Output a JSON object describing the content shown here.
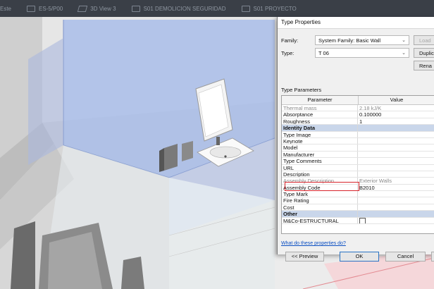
{
  "view_tabs": [
    {
      "label": "Este",
      "icon": "elevation-view-icon"
    },
    {
      "label": "ES-5/P00",
      "icon": "sheet-view-icon"
    },
    {
      "label": "3D View 3",
      "icon": "3d-view-icon"
    },
    {
      "label": "S01 DEMOLICION SEGURIDAD",
      "icon": "floor-plan-icon"
    },
    {
      "label": "S01 PROYECTO",
      "icon": "floor-plan-icon"
    }
  ],
  "dialog": {
    "title": "Type Properties",
    "family_label": "Family:",
    "family_value": "System Family: Basic Wall",
    "type_label": "Type:",
    "type_value": "T 06",
    "load_label": "Load",
    "duplicate_label": "Duplic",
    "rename_label": "Rena",
    "type_parameters_label": "Type Parameters",
    "columns": [
      "Parameter",
      "Value"
    ],
    "rows": [
      {
        "param": "Thermal mass",
        "value": "2.18 kJ/K",
        "kind": "readonly"
      },
      {
        "param": "Absorptance",
        "value": "0.100000",
        "kind": "normal"
      },
      {
        "param": "Roughness",
        "value": "1",
        "kind": "normal"
      },
      {
        "param": "Identity Data",
        "value": "",
        "kind": "group"
      },
      {
        "param": "Type Image",
        "value": "",
        "kind": "normal"
      },
      {
        "param": "Keynote",
        "value": "",
        "kind": "normal"
      },
      {
        "param": "Model",
        "value": "",
        "kind": "normal"
      },
      {
        "param": "Manufacturer",
        "value": "",
        "kind": "normal"
      },
      {
        "param": "Type Comments",
        "value": "",
        "kind": "normal"
      },
      {
        "param": "URL",
        "value": "",
        "kind": "normal"
      },
      {
        "param": "Description",
        "value": "",
        "kind": "normal"
      },
      {
        "param": "Assembly Description",
        "value": "Exterior Walls",
        "kind": "readonly"
      },
      {
        "param": "Assembly Code",
        "value": "B2010",
        "kind": "normal"
      },
      {
        "param": "Type Mark",
        "value": "",
        "kind": "normal"
      },
      {
        "param": "Fire Rating",
        "value": "",
        "kind": "normal"
      },
      {
        "param": "Cost",
        "value": "",
        "kind": "normal"
      },
      {
        "param": "Other",
        "value": "",
        "kind": "group"
      },
      {
        "param": "M&Co-ESTRUCTURAL",
        "value": "",
        "kind": "checkbox"
      }
    ],
    "help_link": "What do these properties do?",
    "preview_button": "<< Preview",
    "ok_button": "OK",
    "cancel_button": "Cancel",
    "apply_button": "A"
  },
  "colors": {
    "accent": "#2a73c4",
    "group_row": "#c9d6ea",
    "highlight_box": "#d8232a",
    "wall_selection": "#9fb4e6"
  }
}
